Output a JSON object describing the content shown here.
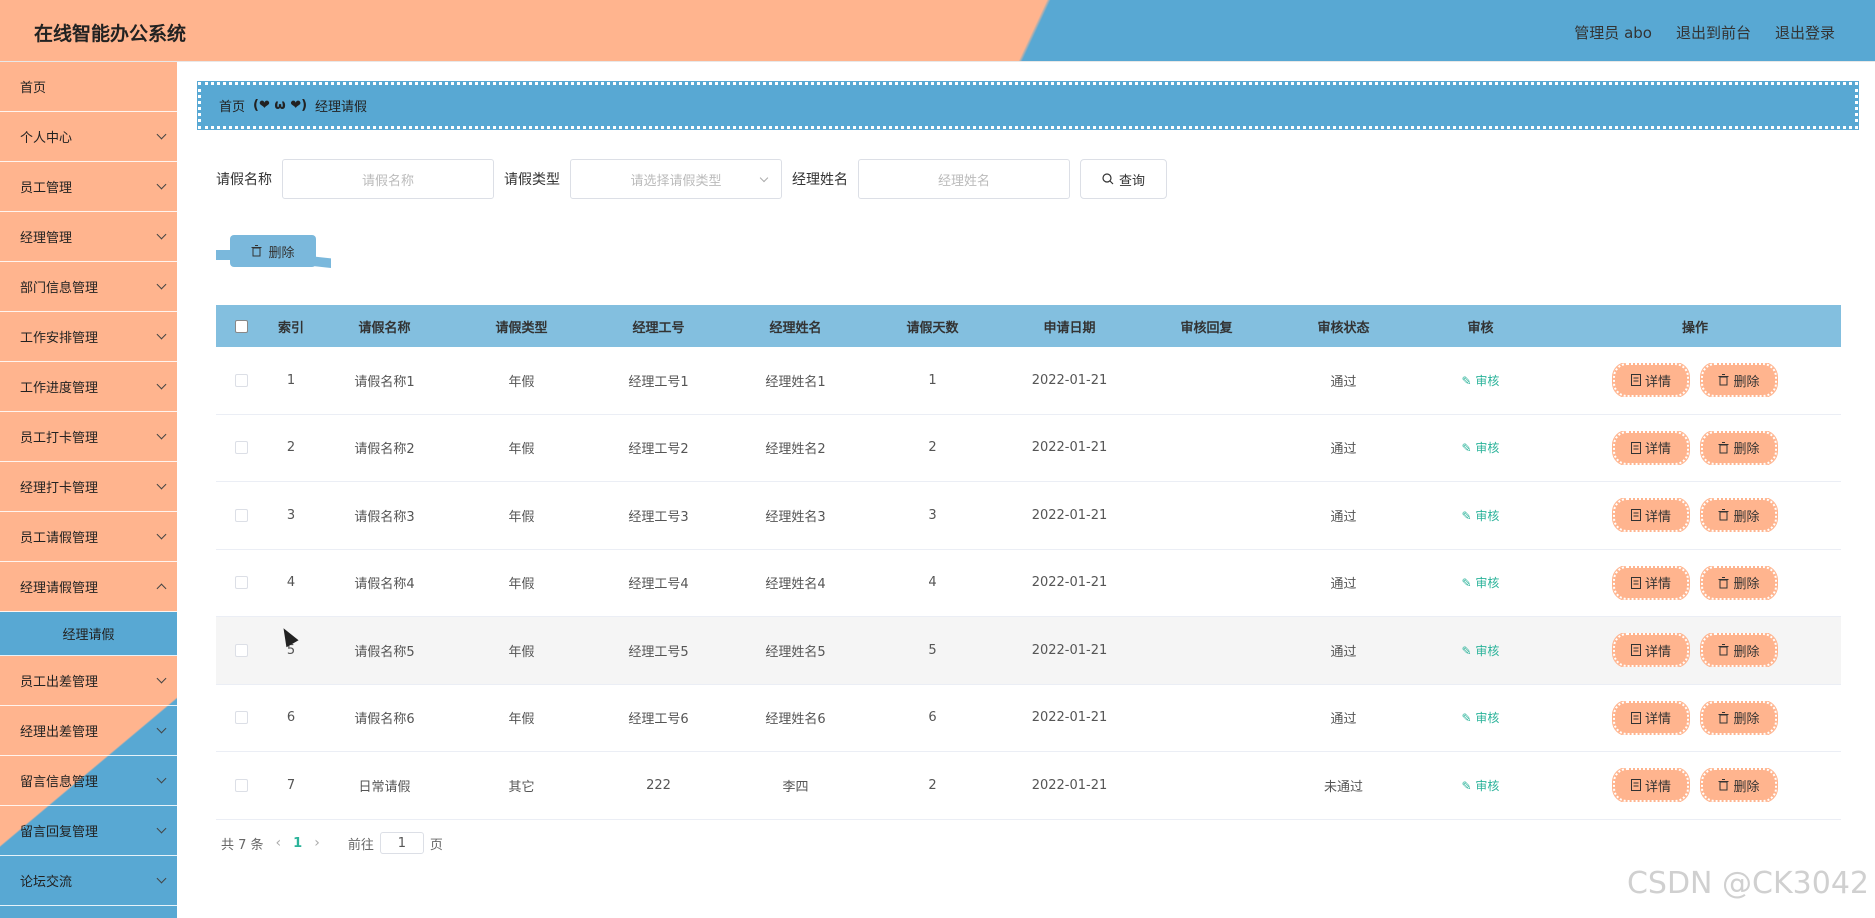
{
  "app": {
    "title": "在线智能办公系统"
  },
  "header_links": {
    "admin": "管理员 abo",
    "to_front": "退出到前台",
    "logout": "退出登录"
  },
  "sidebar": {
    "home": "首页",
    "items_before": [
      "个人中心",
      "员工管理",
      "经理管理",
      "部门信息管理",
      "工作安排管理",
      "工作进度管理",
      "员工打卡管理",
      "经理打卡管理",
      "员工请假管理"
    ],
    "open_item": "经理请假管理",
    "sub_item": "经理请假",
    "items_after": [
      "员工出差管理",
      "经理出差管理",
      "留言信息管理",
      "留言回复管理",
      "论坛交流"
    ]
  },
  "breadcrumb": {
    "home": "首页",
    "sep": "(❤ ω ❤)",
    "current": "经理请假"
  },
  "search": {
    "name_label": "请假名称",
    "name_placeholder": "请假名称",
    "type_label": "请假类型",
    "type_placeholder": "请选择请假类型",
    "manager_label": "经理姓名",
    "manager_placeholder": "经理姓名",
    "query_label": "查询"
  },
  "batch_delete": "删除",
  "table": {
    "headers": [
      "索引",
      "请假名称",
      "请假类型",
      "经理工号",
      "经理姓名",
      "请假天数",
      "申请日期",
      "审核回复",
      "审核状态",
      "审核",
      "操作"
    ],
    "audit_label": "审核",
    "detail_label": "详情",
    "delete_label": "删除",
    "rows": [
      [
        "1",
        "请假名称1",
        "年假",
        "经理工号1",
        "经理姓名1",
        "1",
        "2022-01-21",
        "",
        "通过"
      ],
      [
        "2",
        "请假名称2",
        "年假",
        "经理工号2",
        "经理姓名2",
        "2",
        "2022-01-21",
        "",
        "通过"
      ],
      [
        "3",
        "请假名称3",
        "年假",
        "经理工号3",
        "经理姓名3",
        "3",
        "2022-01-21",
        "",
        "通过"
      ],
      [
        "4",
        "请假名称4",
        "年假",
        "经理工号4",
        "经理姓名4",
        "4",
        "2022-01-21",
        "",
        "通过"
      ],
      [
        "5",
        "请假名称5",
        "年假",
        "经理工号5",
        "经理姓名5",
        "5",
        "2022-01-21",
        "",
        "通过"
      ],
      [
        "6",
        "请假名称6",
        "年假",
        "经理工号6",
        "经理姓名6",
        "6",
        "2022-01-21",
        "",
        "通过"
      ],
      [
        "7",
        "日常请假",
        "其它",
        "222",
        "李四",
        "2",
        "2022-01-21",
        "",
        "未通过"
      ]
    ]
  },
  "pager": {
    "total": "共 7 条",
    "current": "1",
    "goto": "前往",
    "goto_value": "1",
    "page_suffix": "页"
  },
  "watermark": "CSDN @CK3042",
  "colors": {
    "peach": "#ffb48e",
    "blue": "#58a8d3",
    "table_header": "#83bfdf",
    "link_green": "#2bb39a"
  }
}
